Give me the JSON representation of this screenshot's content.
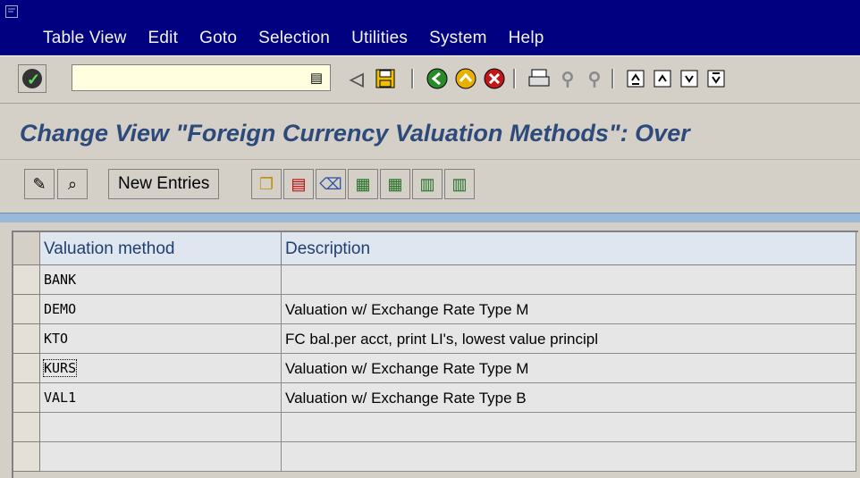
{
  "menu": [
    "Table View",
    "Edit",
    "Goto",
    "Selection",
    "Utilities",
    "System",
    "Help"
  ],
  "command_field": {
    "value": ""
  },
  "title": "Change View \"Foreign Currency Valuation Methods\": Over",
  "toolbar": {
    "new_entries_label": "New Entries"
  },
  "table": {
    "columns": [
      "Valuation method",
      "Description"
    ],
    "rows": [
      {
        "method": "BANK",
        "description": ""
      },
      {
        "method": "DEMO",
        "description": "Valuation w/ Exchange Rate Type M"
      },
      {
        "method": "KTO",
        "description": "FC bal.per acct, print LI's, lowest value principl"
      },
      {
        "method": "KURS",
        "description": "Valuation w/ Exchange Rate Type M"
      },
      {
        "method": "VAL1",
        "description": "Valuation w/ Exchange Rate Type B"
      },
      {
        "method": "",
        "description": ""
      },
      {
        "method": "",
        "description": ""
      }
    ]
  },
  "colors": {
    "menubar": "#000080",
    "title": "#2e4a7b",
    "header": "#dfe6f0",
    "strip": "#9ab8d8"
  }
}
